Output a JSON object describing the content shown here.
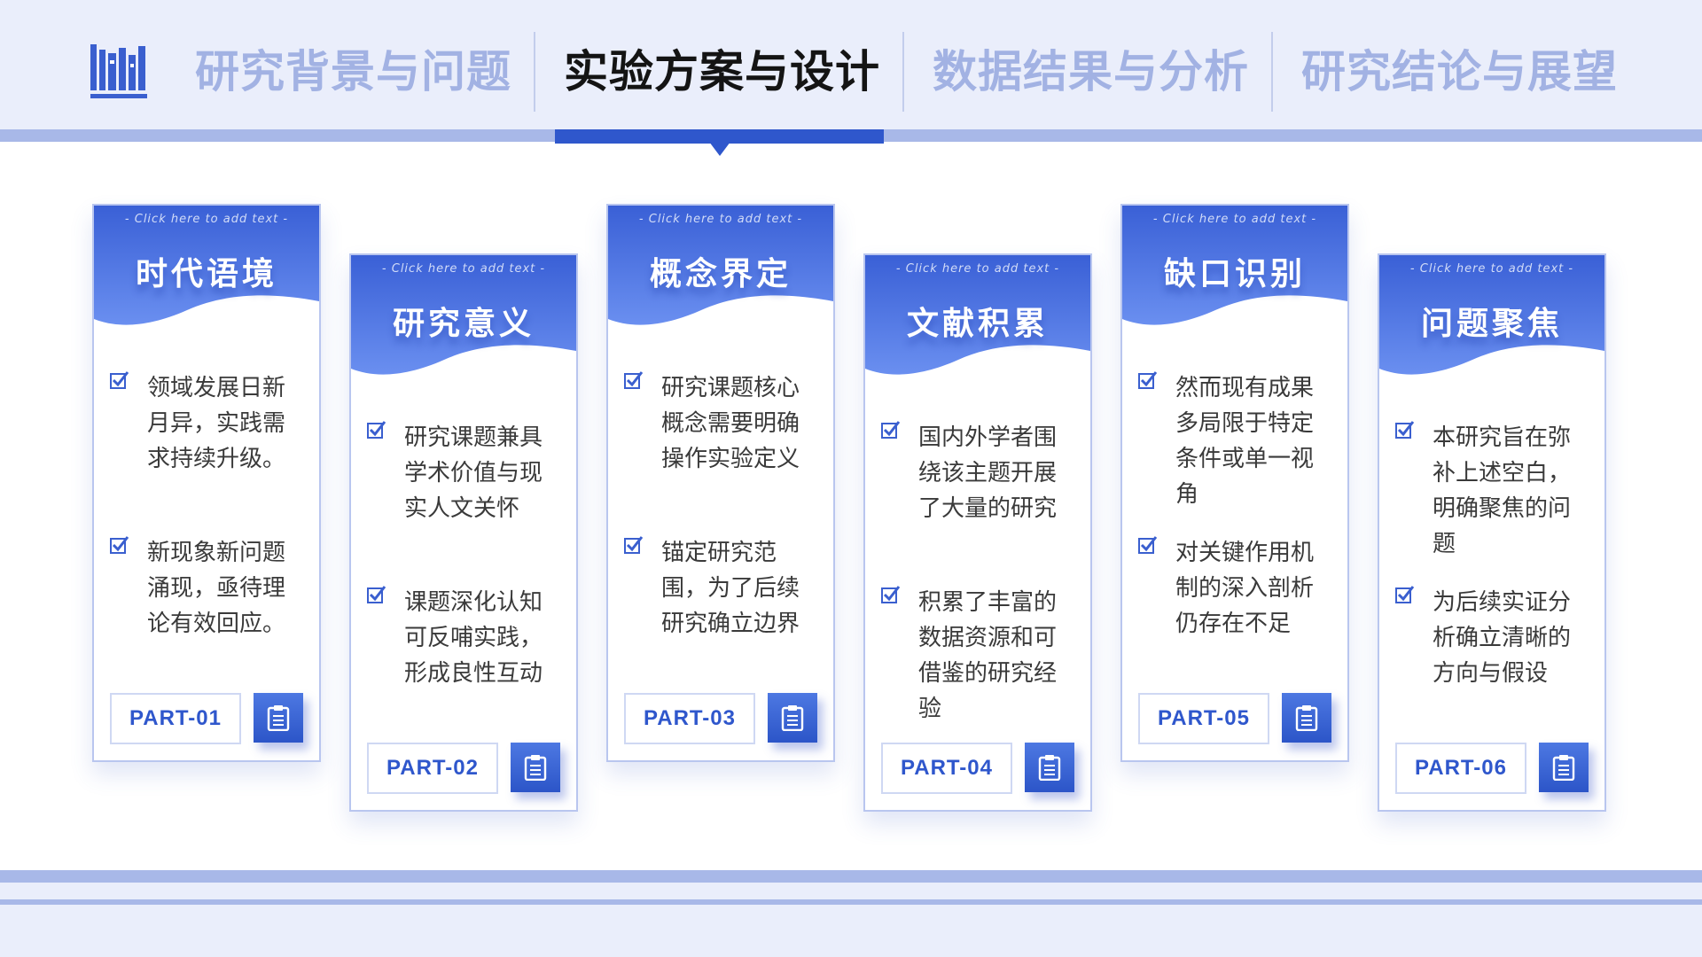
{
  "header": {
    "tabs": [
      {
        "label": "研究背景与问题",
        "active": false
      },
      {
        "label": "实验方案与设计",
        "active": true
      },
      {
        "label": "数据结果与分析",
        "active": false
      },
      {
        "label": "研究结论与展望",
        "active": false
      }
    ],
    "logo_icon": "books-icon"
  },
  "colors": {
    "accent": "#2f57cc",
    "accent_light": "#a8b8e8",
    "header_bg": "#eaeefb",
    "inactive_tab": "#a2b2e3"
  },
  "cards": [
    {
      "subtitle": "- Click here to add text -",
      "title": "时代语境",
      "bullets": [
        "领域发展日新月异，实践需求持续升级。",
        "新现象新问题涌现，亟待理论有效回应。"
      ],
      "part": "PART-01",
      "icon": "clipboard-icon"
    },
    {
      "subtitle": "- Click here to add text -",
      "title": "研究意义",
      "bullets": [
        "研究课题兼具学术价值与现实人文关怀",
        "课题深化认知可反哺实践，形成良性互动"
      ],
      "part": "PART-02",
      "icon": "clipboard-icon"
    },
    {
      "subtitle": "- Click here to add text -",
      "title": "概念界定",
      "bullets": [
        "研究课题核心概念需要明确操作实验定义",
        "锚定研究范围，为了后续研究确立边界"
      ],
      "part": "PART-03",
      "icon": "clipboard-icon"
    },
    {
      "subtitle": "- Click here to add text -",
      "title": "文献积累",
      "bullets": [
        "国内外学者围绕该主题开展了大量的研究",
        "积累了丰富的数据资源和可借鉴的研究经验"
      ],
      "part": "PART-04",
      "icon": "clipboard-icon"
    },
    {
      "subtitle": "- Click here to add text -",
      "title": "缺口识别",
      "bullets": [
        "然而现有成果多局限于特定条件或单一视角",
        "对关键作用机制的深入剖析仍存在不足"
      ],
      "part": "PART-05",
      "icon": "clipboard-icon"
    },
    {
      "subtitle": "- Click here to add text -",
      "title": "问题聚焦",
      "bullets": [
        "本研究旨在弥补上述空白，明确聚焦的问题",
        "为后续实证分析确立清晰的方向与假设"
      ],
      "part": "PART-06",
      "icon": "clipboard-icon"
    }
  ]
}
